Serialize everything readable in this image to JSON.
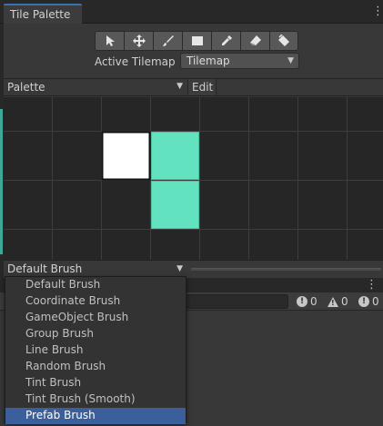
{
  "window": {
    "tab_title": "Tile Palette"
  },
  "toolbar": {
    "tools": [
      {
        "name": "select-tool",
        "icon": "arrow-cursor-icon"
      },
      {
        "name": "move-tool",
        "icon": "move-arrows-icon"
      },
      {
        "name": "paint-tool",
        "icon": "paintbrush-icon"
      },
      {
        "name": "box-fill-tool",
        "icon": "box-icon"
      },
      {
        "name": "picker-tool",
        "icon": "eyedropper-icon"
      },
      {
        "name": "erase-tool",
        "icon": "eraser-icon"
      },
      {
        "name": "fill-tool",
        "icon": "paint-bucket-icon"
      }
    ],
    "active_tilemap_label": "Active Tilemap",
    "active_tilemap_value": "Tilemap"
  },
  "palette": {
    "selected": "Palette",
    "edit_label": "Edit"
  },
  "grid": {
    "tiles": [
      {
        "col": 2,
        "row": 1,
        "color": "#ffffff",
        "selected": true
      },
      {
        "col": 3,
        "row": 1,
        "color": "#63e2bf",
        "selected": false
      },
      {
        "col": 3,
        "row": 2,
        "color": "#63e2bf",
        "selected": false
      }
    ]
  },
  "brush": {
    "selected": "Default Brush",
    "options": [
      "Default Brush",
      "Coordinate Brush",
      "GameObject Brush",
      "Group Brush",
      "Line Brush",
      "Random Brush",
      "Tint Brush",
      "Tint Brush (Smooth)",
      "Prefab Brush"
    ],
    "highlighted_index": 8
  },
  "console": {
    "info_count": "0",
    "warning_count": "0",
    "error_count": "0"
  },
  "colors": {
    "accent": "#3a72b0",
    "tile_green": "#63e2bf",
    "menu_highlight": "#3a5f9b"
  }
}
